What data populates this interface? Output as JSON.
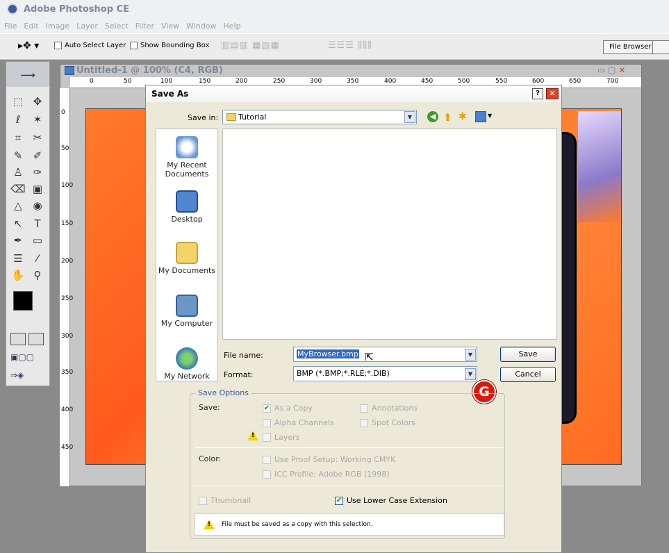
{
  "app": {
    "title": "Adobe Photoshop CE"
  },
  "menu": [
    "File",
    "Edit",
    "Image",
    "Layer",
    "Select",
    "Filter",
    "View",
    "Window",
    "Help"
  ],
  "options": {
    "auto_select": "Auto Select Layer",
    "bounding_box": "Show Bounding Box",
    "file_browser_tab": "File Browser"
  },
  "document": {
    "title": "Untitled-1 @ 100% (C4, RGB)",
    "ruler_top": [
      "0",
      "50",
      "100",
      "150",
      "200",
      "250",
      "300",
      "350",
      "400",
      "450",
      "500",
      "550",
      "600",
      "650",
      "700"
    ],
    "ruler_left": [
      "0",
      "50",
      "100",
      "150",
      "200",
      "250",
      "300",
      "350",
      "400",
      "450"
    ]
  },
  "dialog": {
    "title": "Save As",
    "help": "?",
    "close": "✕",
    "save_in_label": "Save in:",
    "save_in_value": "Tutorial",
    "places": [
      "My Recent Documents",
      "Desktop",
      "My Documents",
      "My Computer",
      "My Network"
    ],
    "file_name_label": "File name:",
    "file_name_value": "MyBrowser.bmp",
    "format_label": "Format:",
    "format_value": "BMP (*.BMP;*.RLE;*.DIB)",
    "save_button": "Save",
    "cancel_button": "Cancel",
    "badge": "G",
    "save_options": {
      "title": "Save Options",
      "save_label": "Save:",
      "as_copy": "As a Copy",
      "annotations": "Annotations",
      "alpha_channels": "Alpha Channels",
      "spot_colors": "Spot Colors",
      "layers": "Layers",
      "color_label": "Color:",
      "proof_setup": "Use Proof Setup:  Working CMYK",
      "icc_profile": "ICC Profile:  Adobe RGB (1998)",
      "thumbnail": "Thumbnail",
      "lower_case": "Use Lower Case Extension",
      "warning": "File must be saved as a copy with this selection."
    }
  }
}
